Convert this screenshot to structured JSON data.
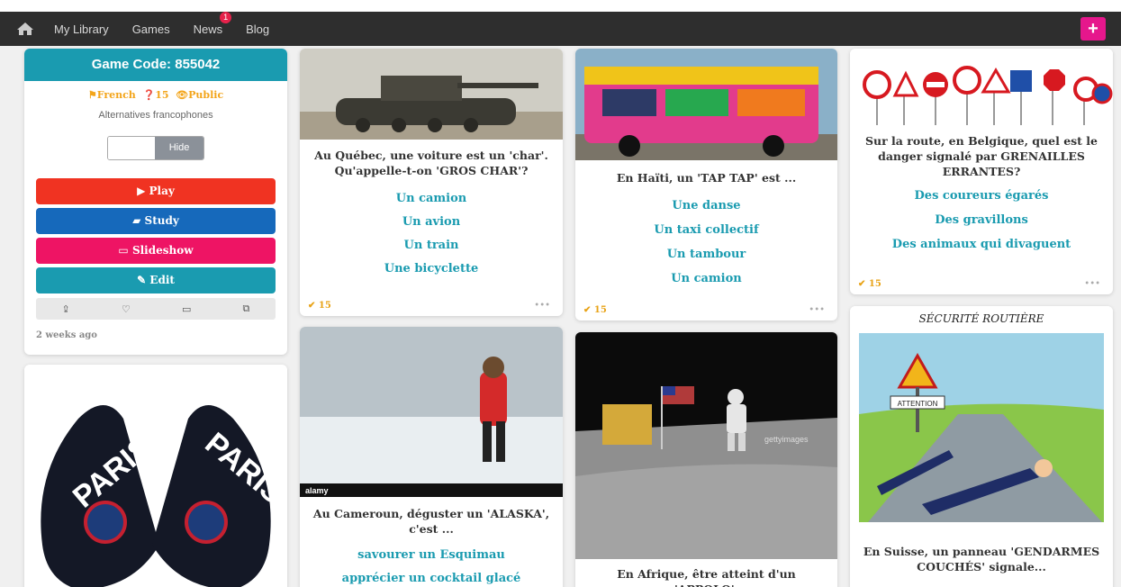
{
  "nav": {
    "links": [
      "My Library",
      "Games",
      "News",
      "Blog"
    ],
    "news_badge": "1",
    "plus": "+"
  },
  "game": {
    "code_title": "Game Code: 855042",
    "language": "French",
    "count": "15",
    "visibility": "Public",
    "subtitle": "Alternatives francophones",
    "toggle_label": "Hide",
    "play": "Play",
    "study": "Study",
    "slideshow": "Slideshow",
    "edit": "Edit",
    "age": "2 weeks ago",
    "colors": {
      "head": "#1a9bb0",
      "play": "#f03322",
      "study": "#1669bb",
      "slideshow": "#ee1464",
      "edit": "#1a9bb0"
    }
  },
  "q1": {
    "question": "Au Québec, une voiture est un 'char'. Qu'appelle-t-on 'GROS CHAR'?",
    "answers": [
      "Un camion",
      "Un avion",
      "Un train",
      "Une bicyclette"
    ],
    "score": "15"
  },
  "q2": {
    "question": "En Haïti, un 'TAP TAP' est ...",
    "answers": [
      "Une danse",
      "Un taxi collectif",
      "Un tambour",
      "Un camion"
    ],
    "score": "15"
  },
  "q3": {
    "question": "Sur la route, en Belgique, quel est le danger signalé par  GRENAILLES ERRANTES?",
    "answers": [
      "Des coureurs égarés",
      "Des gravillons",
      "Des animaux qui divaguent"
    ],
    "score": "15"
  },
  "q4": {
    "question": "Au Cameroun, déguster un 'ALASKA', c'est ...",
    "answers": [
      "savourer un Esquimau",
      "apprécier un cocktail glacé"
    ],
    "watermark": "alamy"
  },
  "q5": {
    "question": "En Afrique, être atteint d'un 'APPOLO',",
    "watermark": "gettyimages"
  },
  "q6": {
    "caption": "SÉCURITÉ ROUTIÈRE",
    "sign_text": "ATTENTION",
    "question": "En Suisse, un panneau 'GENDARMES COUCHÉS' signale..."
  },
  "psg": {
    "text": "PARIS"
  }
}
